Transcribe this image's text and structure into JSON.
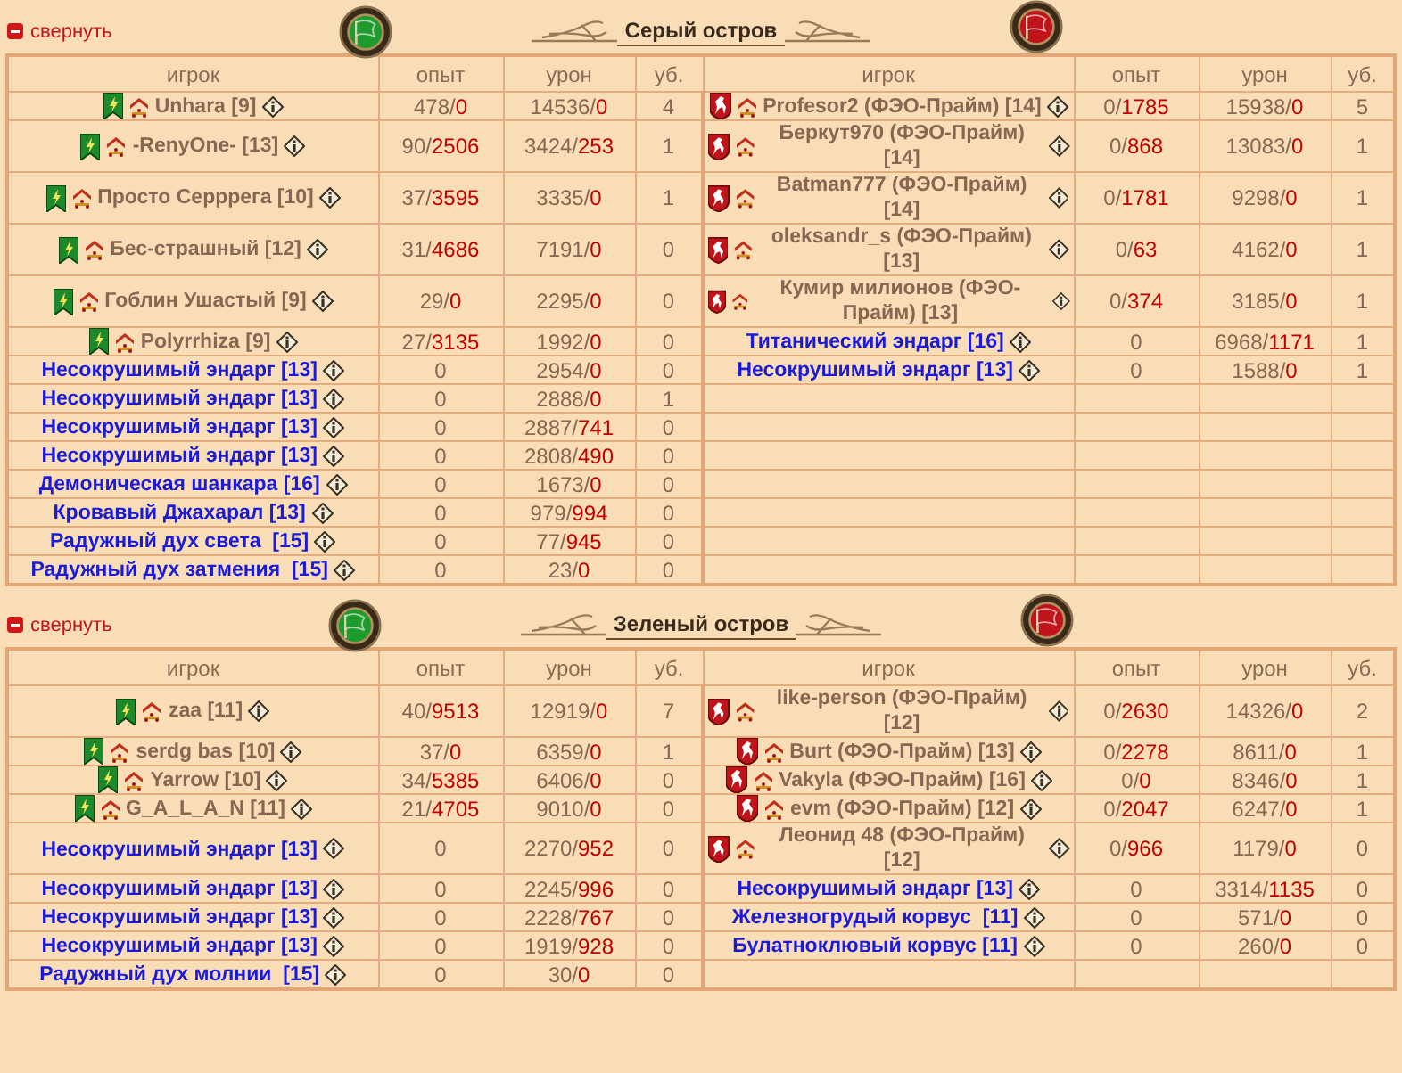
{
  "sections": [
    {
      "collapse_label": "свернуть",
      "title": "Серый остров",
      "teams": [
        {
          "kind": "banner",
          "color": "#1f9a2c",
          "columns": [
            "игрок",
            "опыт",
            "урон",
            "уб."
          ],
          "rows": [
            {
              "kind": "player",
              "name": "Unhara [9]",
              "exp": "478/0",
              "damage": "14536/0",
              "kills": "4"
            },
            {
              "kind": "player",
              "name": "-RenyOne- [13]",
              "exp": "90/2506",
              "damage": "3424/253",
              "kills": "1"
            },
            {
              "kind": "player",
              "name": "Просто Серррега [10]",
              "exp": "37/3595",
              "damage": "3335/0",
              "kills": "1"
            },
            {
              "kind": "player",
              "name": "Бес-страшный [12]",
              "exp": "31/4686",
              "damage": "7191/0",
              "kills": "0"
            },
            {
              "kind": "player",
              "name": "Гоблин Ушастый [9]",
              "exp": "29/0",
              "damage": "2295/0",
              "kills": "0"
            },
            {
              "kind": "player",
              "name": "Polyrrhiza [9]",
              "exp": "27/3135",
              "damage": "1992/0",
              "kills": "0"
            },
            {
              "kind": "bot",
              "name": "Несокрушимый эндарг [13]",
              "exp": "0",
              "damage": "2954/0",
              "kills": "0"
            },
            {
              "kind": "bot",
              "name": "Несокрушимый эндарг [13]",
              "exp": "0",
              "damage": "2888/0",
              "kills": "1"
            },
            {
              "kind": "bot",
              "name": "Несокрушимый эндарг [13]",
              "exp": "0",
              "damage": "2887/741",
              "kills": "0"
            },
            {
              "kind": "bot",
              "name": "Несокрушимый эндарг [13]",
              "exp": "0",
              "damage": "2808/490",
              "kills": "0"
            },
            {
              "kind": "bot",
              "name": "Демоническая шанкара [16]",
              "exp": "0",
              "damage": "1673/0",
              "kills": "0"
            },
            {
              "kind": "bot",
              "name": "Кровавый Джахарал [13]",
              "exp": "0",
              "damage": "979/994",
              "kills": "0"
            },
            {
              "kind": "bot",
              "name": "Радужный дух света  [15]",
              "exp": "0",
              "damage": "77/945",
              "kills": "0"
            },
            {
              "kind": "bot",
              "name": "Радужный дух затмения  [15]",
              "exp": "0",
              "damage": "23/0",
              "kills": "0"
            }
          ]
        },
        {
          "kind": "shield",
          "color": "#c0141a",
          "columns": [
            "игрок",
            "опыт",
            "урон",
            "уб."
          ],
          "rows": [
            {
              "kind": "player",
              "name": "Profesor2 (ФЭО-Прайм) [14]",
              "exp": "0/1785",
              "damage": "15938/0",
              "kills": "5"
            },
            {
              "kind": "player",
              "name": "Беркут970 (ФЭО-Прайм) [14]",
              "exp": "0/868",
              "damage": "13083/0",
              "kills": "1"
            },
            {
              "kind": "player",
              "name": "Batman777 (ФЭО-Прайм) [14]",
              "exp": "0/1781",
              "damage": "9298/0",
              "kills": "1"
            },
            {
              "kind": "player",
              "name": "oleksandr_s (ФЭО-Прайм) [13]",
              "exp": "0/63",
              "damage": "4162/0",
              "kills": "1"
            },
            {
              "kind": "player",
              "name": "Кумир милионов (ФЭО-Прайм) [13]",
              "exp": "0/374",
              "damage": "3185/0",
              "kills": "1"
            },
            {
              "kind": "bot",
              "name": "Титанический эндарг [16]",
              "exp": "0",
              "damage": "6968/1171",
              "kills": "1"
            },
            {
              "kind": "bot",
              "name": "Несокрушимый эндарг [13]",
              "exp": "0",
              "damage": "1588/0",
              "kills": "1"
            }
          ]
        }
      ]
    },
    {
      "collapse_label": "свернуть",
      "title": "Зеленый остров",
      "teams": [
        {
          "kind": "banner",
          "color": "#1f9a2c",
          "columns": [
            "игрок",
            "опыт",
            "урон",
            "уб."
          ],
          "rows": [
            {
              "kind": "player",
              "name": "zaa [11]",
              "exp": "40/9513",
              "damage": "12919/0",
              "kills": "7"
            },
            {
              "kind": "player",
              "name": "serdg bas [10]",
              "exp": "37/0",
              "damage": "6359/0",
              "kills": "1"
            },
            {
              "kind": "player",
              "name": "Yarrow [10]",
              "exp": "34/5385",
              "damage": "6406/0",
              "kills": "0"
            },
            {
              "kind": "player",
              "name": "G_A_L_A_N [11]",
              "exp": "21/4705",
              "damage": "9010/0",
              "kills": "0"
            },
            {
              "kind": "bot",
              "name": "Несокрушимый эндарг [13]",
              "exp": "0",
              "damage": "2270/952",
              "kills": "0"
            },
            {
              "kind": "bot",
              "name": "Несокрушимый эндарг [13]",
              "exp": "0",
              "damage": "2245/996",
              "kills": "0"
            },
            {
              "kind": "bot",
              "name": "Несокрушимый эндарг [13]",
              "exp": "0",
              "damage": "2228/767",
              "kills": "0"
            },
            {
              "kind": "bot",
              "name": "Несокрушимый эндарг [13]",
              "exp": "0",
              "damage": "1919/928",
              "kills": "0"
            },
            {
              "kind": "bot",
              "name": "Радужный дух молнии  [15]",
              "exp": "0",
              "damage": "30/0",
              "kills": "0"
            }
          ]
        },
        {
          "kind": "shield",
          "color": "#c0141a",
          "columns": [
            "игрок",
            "опыт",
            "урон",
            "уб."
          ],
          "rows": [
            {
              "kind": "player",
              "name": "like-person (ФЭО-Прайм) [12]",
              "exp": "0/2630",
              "damage": "14326/0",
              "kills": "2"
            },
            {
              "kind": "player",
              "name": "Burt (ФЭО-Прайм) [13]",
              "exp": "0/2278",
              "damage": "8611/0",
              "kills": "1"
            },
            {
              "kind": "player",
              "name": "Vakyla (ФЭО-Прайм) [16]",
              "exp": "0/0",
              "damage": "8346/0",
              "kills": "1"
            },
            {
              "kind": "player",
              "name": "evm (ФЭО-Прайм) [12]",
              "exp": "0/2047",
              "damage": "6247/0",
              "kills": "1"
            },
            {
              "kind": "player",
              "name": "Леонид 48 (ФЭО-Прайм) [12]",
              "exp": "0/966",
              "damage": "1179/0",
              "kills": "0"
            },
            {
              "kind": "bot",
              "name": "Несокрушимый эндарг [13]",
              "exp": "0",
              "damage": "3314/1135",
              "kills": "0"
            },
            {
              "kind": "bot",
              "name": "Железногрудый корвус  [11]",
              "exp": "0",
              "damage": "571/0",
              "kills": "0"
            },
            {
              "kind": "bot",
              "name": "Булатноклювый корвус [11]",
              "exp": "0",
              "damage": "260/0",
              "kills": "0"
            }
          ]
        }
      ]
    }
  ]
}
